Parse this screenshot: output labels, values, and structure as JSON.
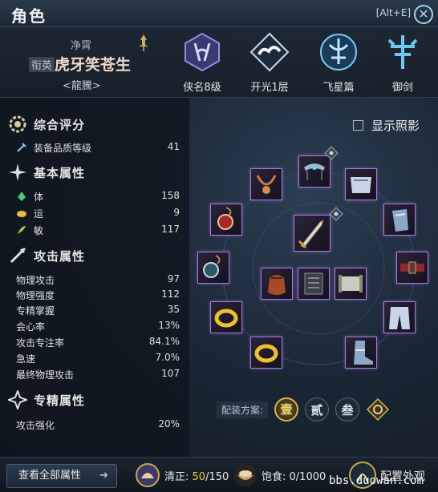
{
  "window": {
    "title": "角色",
    "hotkey": "[Alt+E]"
  },
  "character": {
    "guild": "净霄",
    "rank_badge": "衔英",
    "name": "虎牙笑苍生",
    "subtitle": "<龍騰>"
  },
  "ranks": [
    {
      "label": "侠名8级",
      "icon": "knight-rank-icon"
    },
    {
      "label": "开光1层",
      "icon": "cloud-emblem-icon"
    },
    {
      "label": "飞星篇",
      "icon": "flying-star-icon"
    },
    {
      "label": "御剑",
      "icon": "sword-flight-icon"
    }
  ],
  "sections": {
    "overall": {
      "title": "综合评分",
      "rows": [
        {
          "label": "装备品质等级",
          "value": "41"
        }
      ]
    },
    "basic": {
      "title": "基本属性",
      "rows": [
        {
          "label": "体",
          "value": "158"
        },
        {
          "label": "运",
          "value": "9"
        },
        {
          "label": "敏",
          "value": "117"
        }
      ]
    },
    "attack": {
      "title": "攻击属性",
      "rows": [
        {
          "label": "物理攻击",
          "value": "97"
        },
        {
          "label": "物理强度",
          "value": "112"
        },
        {
          "label": "专精掌握",
          "value": "35"
        },
        {
          "label": "会心率",
          "value": "13%"
        },
        {
          "label": "攻击专注率",
          "value": "84.1%"
        },
        {
          "label": "急速",
          "value": "7.0%"
        },
        {
          "label": "最终物理攻击",
          "value": "107"
        }
      ]
    },
    "specialty": {
      "title": "专精属性",
      "rows": [
        {
          "label": "攻击强化",
          "value": "20%"
        }
      ]
    }
  },
  "show_shadow": {
    "label": "显示照影",
    "checked": false
  },
  "loadout": {
    "label": "配装方案:",
    "presets": [
      "壹",
      "贰",
      "叁"
    ]
  },
  "bottom": {
    "all_attrs_label": "查看全部属性",
    "arrow": "➔",
    "purity_label": "清正:",
    "purity_value": "50",
    "purity_max": "/150",
    "satiety_label": "饱食:",
    "satiety_value": "0/1000",
    "appearance_label": "配置外观"
  },
  "watermark": "bbs.duowan.com",
  "colors": {
    "accent": "#a77ce0",
    "gold": "#f5c842"
  }
}
